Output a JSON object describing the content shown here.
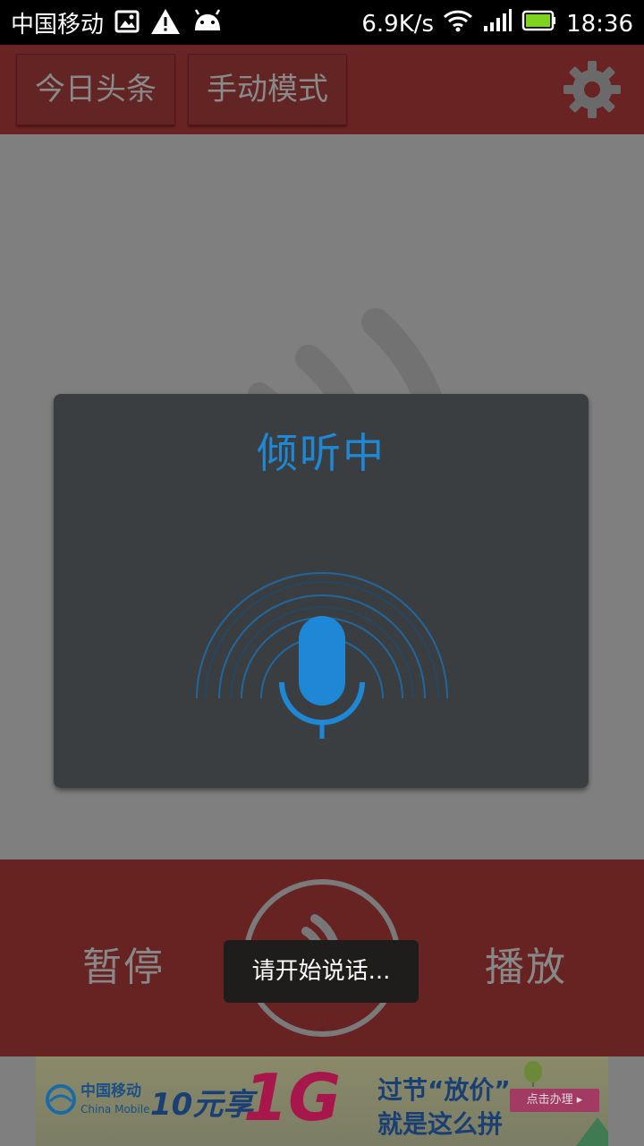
{
  "status_bar": {
    "carrier": "中国移动",
    "speed": "6.9K/s",
    "time": "18:36"
  },
  "appbar": {
    "tab1_label": "今日头条",
    "tab2_label": "手动模式"
  },
  "dialog": {
    "title": "倾听中"
  },
  "controls": {
    "pause_label": "暂停",
    "play_label": "播放"
  },
  "toast": {
    "message": "请开始说话..."
  },
  "ad": {
    "brand": "中国移动",
    "brand_en": "China Mobile",
    "offer": "10元享",
    "big": "1G",
    "line1": "过节“放价”",
    "line2": "就是这么拼",
    "cta": "点击办理 ▸"
  },
  "colors": {
    "accent_blue": "#1e88d6",
    "appbar_red": "#6a2323",
    "dialog_bg": "#3b3e40",
    "battery_green": "#7fd320"
  },
  "icons": [
    "image-icon",
    "warning-icon",
    "android-icon",
    "wifi-icon",
    "signal-icon",
    "battery-icon",
    "gear-icon",
    "microphone-icon",
    "sound-wave-icon"
  ]
}
